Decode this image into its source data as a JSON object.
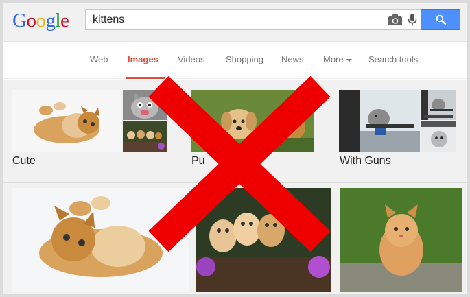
{
  "logo": {
    "letters": [
      "G",
      "o",
      "o",
      "g",
      "l",
      "e"
    ],
    "colors": [
      "#3369e8",
      "#d50f25",
      "#eeb211",
      "#3369e8",
      "#009925",
      "#d50f25"
    ]
  },
  "search": {
    "value": "kittens",
    "camera_icon": "camera-icon",
    "mic_icon": "microphone-icon",
    "button_icon": "magnifier-icon"
  },
  "tabs": {
    "web": "Web",
    "images": "Images",
    "videos": "Videos",
    "shopping": "Shopping",
    "news": "News",
    "more": "More",
    "search_tools": "Search tools"
  },
  "groups": {
    "cute": "Cute",
    "puppies": "Pu",
    "guns": "With Guns"
  },
  "colors": {
    "accent": "#dd4b39",
    "search_button": "#4d90fe",
    "overlay_x": "#ee0000"
  }
}
